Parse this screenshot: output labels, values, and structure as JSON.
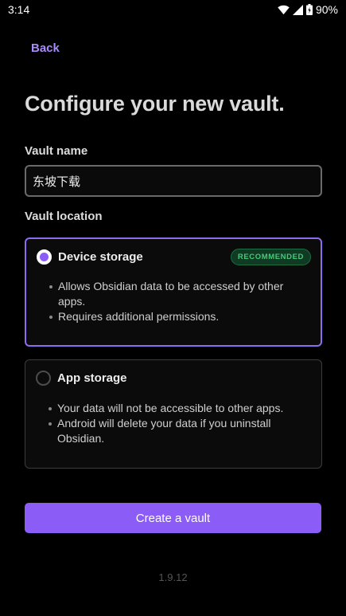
{
  "status_bar": {
    "time": "3:14",
    "battery": "90%",
    "icons": [
      "wifi-icon",
      "signal-icon",
      "battery-icon"
    ]
  },
  "nav": {
    "back_label": "Back"
  },
  "page": {
    "title": "Configure your new vault."
  },
  "vault_name": {
    "label": "Vault name",
    "value": "东坡下载"
  },
  "vault_location": {
    "label": "Vault location",
    "options": [
      {
        "title": "Device storage",
        "badge": "RECOMMENDED",
        "selected": true,
        "bullets": [
          "Allows Obsidian data to be accessed by other apps.",
          "Requires additional permissions."
        ]
      },
      {
        "title": "App storage",
        "selected": false,
        "bullets": [
          "Your data will not be accessible to other apps.",
          "Android will delete your data if you uninstall Obsidian."
        ]
      }
    ]
  },
  "actions": {
    "create_label": "Create a vault"
  },
  "footer": {
    "version": "1.9.12"
  },
  "colors": {
    "accent": "#8b5cf6",
    "back_link": "#a88bfa",
    "badge_text": "#47c97a",
    "background": "#000000"
  }
}
